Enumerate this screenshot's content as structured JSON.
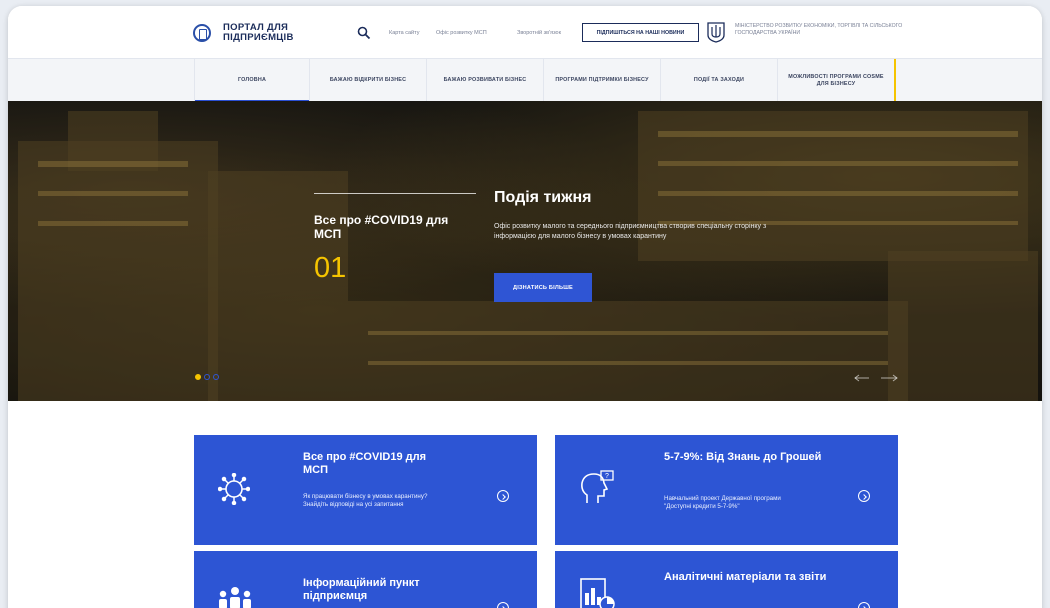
{
  "header": {
    "logo_text": "ПОРТАЛ ДЛЯ ПІДПРИЄМЦІВ",
    "links": [
      "Карта сайту",
      "Офіс розвитку МСП",
      "Зворотній зв'язок"
    ],
    "subscribe_label": "ПІДПИШІТЬСЯ НА НАШІ НОВИНИ",
    "ministry": "МІНІСТЕРСТВО РОЗВИТКУ ЕКОНОМІКИ, ТОРГІВЛІ ТА СІЛЬСЬКОГО ГОСПОДАРСТВА УКРАЇНИ"
  },
  "nav": {
    "items": [
      "ГОЛОВНА",
      "БАЖАЮ ВІДКРИТИ БІЗНЕС",
      "БАЖАЮ РОЗВИВАТИ БІЗНЕС",
      "ПРОГРАМИ ПІДТРИМКИ БІЗНЕСУ",
      "ПОДІЇ ТА ЗАХОДИ",
      "МОЖЛИВОСТІ ПРОГРАМИ COSME ДЛЯ БІЗНЕСУ"
    ],
    "active_index": 0
  },
  "hero": {
    "left_title": "Все про #COVID19 для МСП",
    "number": "01",
    "title": "Подія тижня",
    "description": "Офіс розвитку малого та середнього підприємництва створив спеціальну сторінку з інформацією для малого бізнесу в умовах карантину",
    "button_label": "ДІЗНАТИСЬ БІЛЬШЕ",
    "slide_count": 3,
    "active_slide": 1
  },
  "cards": [
    {
      "title": "Все про #COVID19 для МСП",
      "description": "Як працювати бізнесу в умовах карантину? Знайдіть відповіді на усі запитання",
      "icon": "virus-icon"
    },
    {
      "title": "5-7-9%: Від Знань до Грошей",
      "description": "Навчальний проект Державної програми \"Доступні кредити 5-7-9%\"",
      "icon": "head-idea-icon"
    },
    {
      "title": "Інформаційний пункт підприємця",
      "description": "",
      "icon": "people-icon"
    },
    {
      "title": "Аналітичні матеріали та звіти",
      "description": "",
      "icon": "report-icon"
    }
  ],
  "colors": {
    "primary_blue": "#2d55d4",
    "accent_yellow": "#f5c400",
    "dark_navy": "#1b2c5a"
  }
}
